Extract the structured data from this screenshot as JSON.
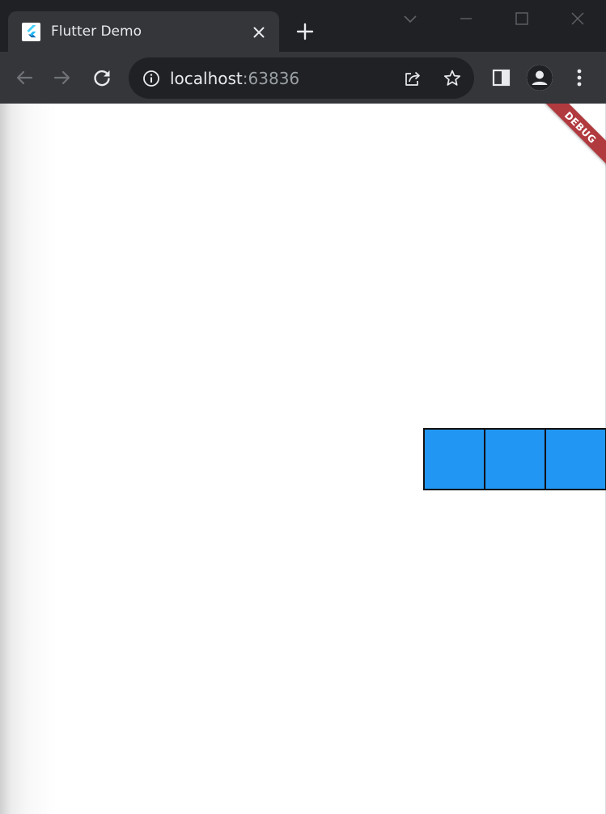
{
  "browser": {
    "tab": {
      "title": "Flutter Demo",
      "favicon": "flutter-logo-icon"
    },
    "address_bar": {
      "host": "localhost",
      "port": ":63836"
    },
    "icons": {
      "back": "arrow-left-icon",
      "forward": "arrow-right-icon",
      "reload": "reload-icon",
      "site_info": "info-icon",
      "share": "share-icon",
      "bookmark": "star-icon",
      "side_panel": "side-panel-icon",
      "profile": "person-icon",
      "menu": "kebab-menu-icon"
    },
    "colors": {
      "titlebar": "#202124",
      "toolbar": "#35363a",
      "omnibox": "#202124"
    }
  },
  "app": {
    "debug_banner": "DEBUG",
    "box_color": "#2196f3",
    "boxes": [
      {
        "id": 1
      },
      {
        "id": 2
      },
      {
        "id": 3
      }
    ]
  }
}
